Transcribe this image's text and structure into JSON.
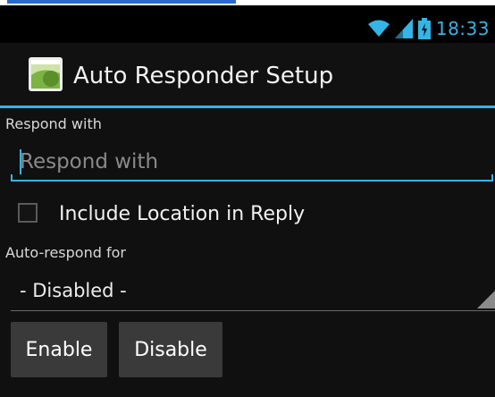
{
  "status_bar": {
    "time": "18:33",
    "icons": [
      "wifi-icon",
      "signal-icon",
      "battery-icon"
    ],
    "accent": "#33b5e5"
  },
  "action_bar": {
    "title": "Auto Responder Setup",
    "icon": "android-app-icon"
  },
  "form": {
    "respond_label": "Respond with",
    "respond_placeholder": "Respond with",
    "respond_value": "",
    "include_location_label": "Include Location in Reply",
    "include_location_checked": false,
    "auto_respond_label": "Auto-respond for",
    "auto_respond_selected": "- Disabled -"
  },
  "buttons": {
    "enable_label": "Enable",
    "disable_label": "Disable"
  },
  "colors": {
    "accent": "#33b5e5",
    "background": "#101010",
    "button": "#3a3a3a"
  }
}
